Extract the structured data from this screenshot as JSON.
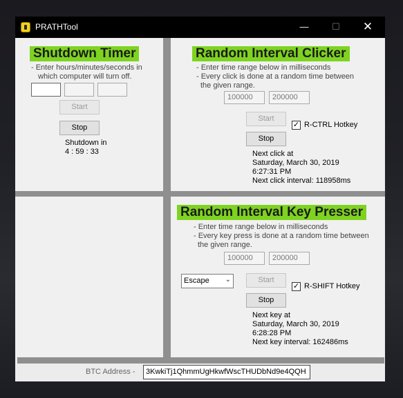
{
  "window": {
    "title": "PRATHTool",
    "controls": {
      "minimize": "—",
      "maximize": "☐",
      "close": "✕"
    }
  },
  "shutdown_timer": {
    "title": "Shutdown Timer",
    "desc_line1": "- Enter hours/minutes/seconds in",
    "desc_line2": "which computer will turn off.",
    "hours_value": "",
    "minutes_value": "",
    "seconds_value": "",
    "start_label": "Start",
    "stop_label": "Stop",
    "status_line1": "Shutdown in",
    "status_line2": "4 : 59 : 33"
  },
  "clicker": {
    "title": "Random Interval Clicker",
    "desc_line1": "- Enter time range below in milliseconds",
    "desc_line2": "- Every click is done at a random time between",
    "desc_line3": "the given range.",
    "min_value": "100000",
    "max_value": "200000",
    "start_label": "Start",
    "stop_label": "Stop",
    "hotkey_label": "R-CTRL Hotkey",
    "hotkey_checked": "✓",
    "next_line1": "Next click at",
    "next_line2": "Saturday, March 30, 2019",
    "next_line3": "6:27:31 PM",
    "next_line4": "Next click interval: 118958ms"
  },
  "key_presser": {
    "title": "Random Interval Key Presser",
    "desc_line1": "- Enter time range below in milliseconds",
    "desc_line2": "- Every key press is done at a random time between",
    "desc_line3": "the given range.",
    "min_value": "100000",
    "max_value": "200000",
    "key_select": "Escape",
    "start_label": "Start",
    "stop_label": "Stop",
    "hotkey_label": "R-SHIFT Hotkey",
    "hotkey_checked": "✓",
    "next_line1": "Next key at",
    "next_line2": "Saturday, March 30, 2019",
    "next_line3": "6:28:28 PM",
    "next_line4": "Next key interval: 162486ms"
  },
  "footer": {
    "btc_label": "BTC Address -",
    "btc_value": "3KwkiTj1QhmmUgHkwfWscTHUDbNd9e4QQH"
  }
}
